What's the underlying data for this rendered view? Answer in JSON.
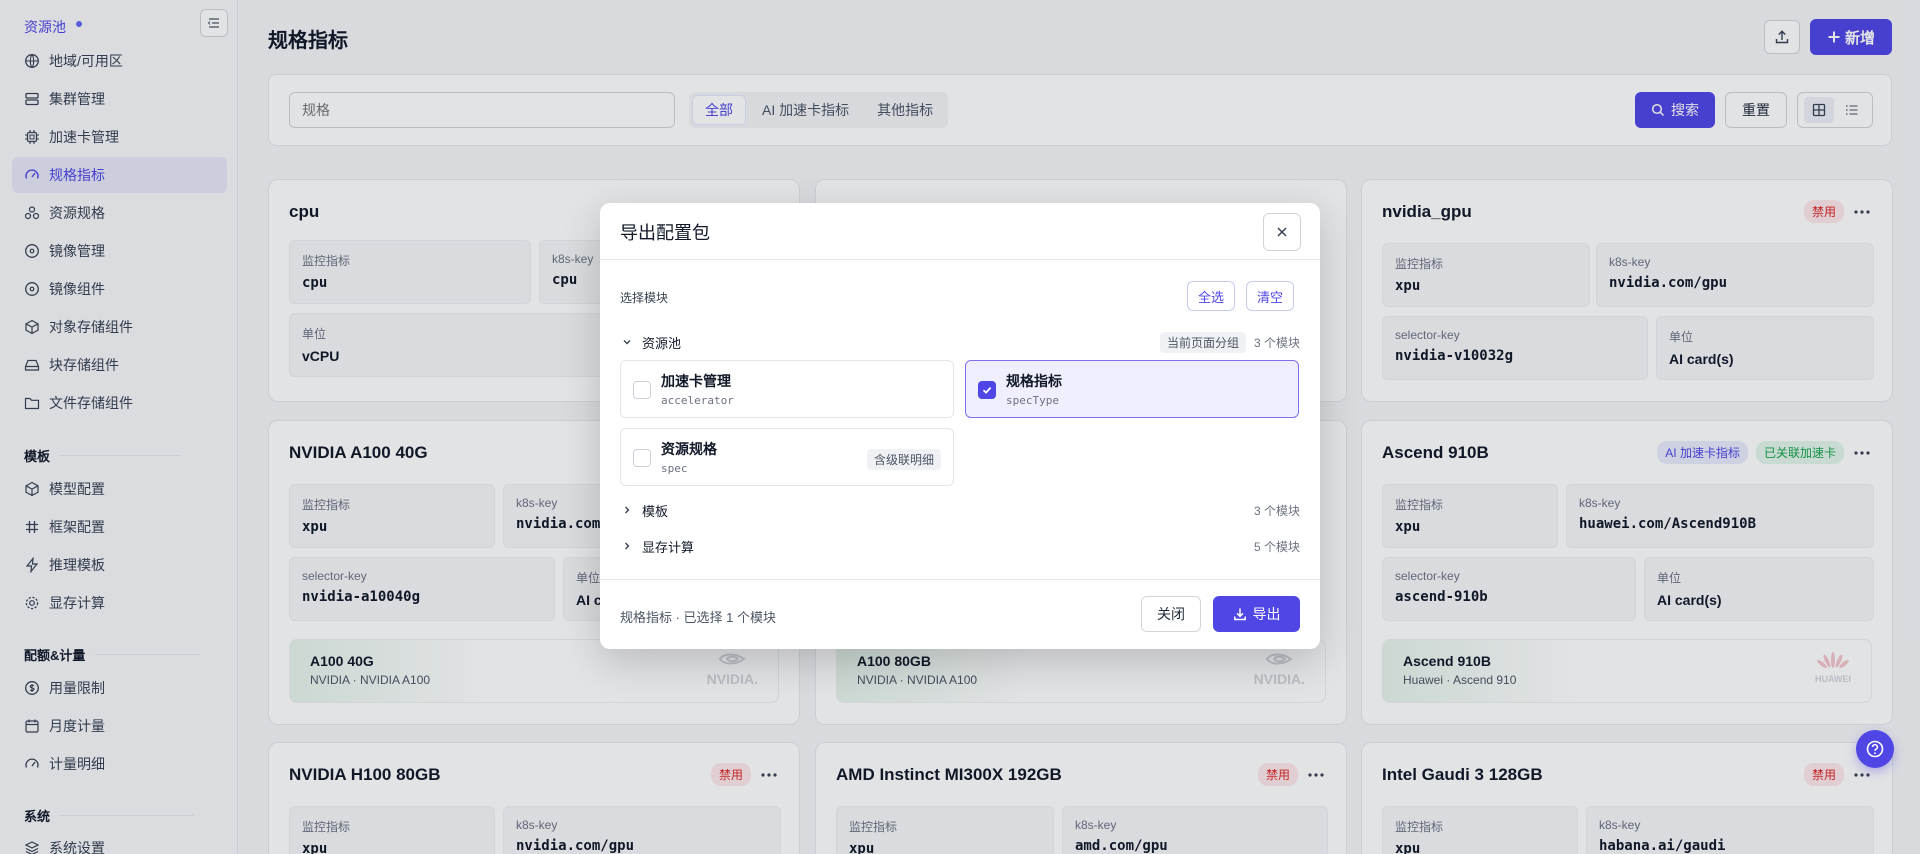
{
  "sidebar": {
    "brand": "资源池",
    "items_pool": [
      {
        "label": "地域/可用区",
        "icon": "globe-icon"
      },
      {
        "label": "集群管理",
        "icon": "server-icon"
      },
      {
        "label": "加速卡管理",
        "icon": "chip-icon"
      },
      {
        "label": "规格指标",
        "icon": "gauge-icon"
      },
      {
        "label": "资源规格",
        "icon": "cluster-icon"
      },
      {
        "label": "镜像管理",
        "icon": "disc-icon"
      },
      {
        "label": "镜像组件",
        "icon": "disc-icon"
      },
      {
        "label": "对象存储组件",
        "icon": "cube-icon"
      },
      {
        "label": "块存储组件",
        "icon": "drive-icon"
      },
      {
        "label": "文件存储组件",
        "icon": "folder-icon"
      }
    ],
    "group_template": "模板",
    "items_template": [
      {
        "label": "模型配置",
        "icon": "cube-icon"
      },
      {
        "label": "框架配置",
        "icon": "hash-icon"
      },
      {
        "label": "推理模板",
        "icon": "bolt-icon"
      },
      {
        "label": "显存计算",
        "icon": "gear-icon"
      }
    ],
    "group_quota": "配额&计量",
    "items_quota": [
      {
        "label": "用量限制",
        "icon": "dollar-icon"
      },
      {
        "label": "月度计量",
        "icon": "calendar-icon"
      },
      {
        "label": "计量明细",
        "icon": "gauge-icon"
      }
    ],
    "group_system": "系统",
    "items_system": [
      {
        "label": "系统设置",
        "icon": "layers-icon"
      }
    ]
  },
  "header": {
    "title": "规格指标",
    "new_label": "新增"
  },
  "filters": {
    "search_placeholder": "规格",
    "segments": [
      "全部",
      "AI 加速卡指标",
      "其他指标"
    ],
    "search_label": "搜索",
    "reset_label": "重置"
  },
  "cards": [
    {
      "title": "cpu",
      "fields": [
        {
          "label": "监控指标",
          "value": "cpu"
        },
        {
          "label": "k8s-key",
          "value": "cpu"
        },
        {
          "label": "单位",
          "value": "vCPU"
        }
      ]
    },
    {
      "title": "nvidia_gpu",
      "badge": "禁用",
      "fields": [
        {
          "label": "监控指标",
          "value": "xpu"
        },
        {
          "label": "k8s-key",
          "value": "nvidia.com/gpu"
        },
        {
          "label": "selector-key",
          "value": "nvidia-v10032g"
        },
        {
          "label": "单位",
          "value": "AI card(s)"
        }
      ]
    },
    {
      "title": "NVIDIA A100 40G",
      "fields": [
        {
          "label": "监控指标",
          "value": "xpu"
        },
        {
          "label": "k8s-key",
          "value": "nvidia.com"
        },
        {
          "label": "selector-key",
          "value": "nvidia-a10040g"
        },
        {
          "label": "单位",
          "value": "AI c"
        }
      ],
      "accel": {
        "name": "A100 40G",
        "sub": "NVIDIA · NVIDIA A100",
        "logo": "NVIDIA."
      }
    },
    {
      "accel": {
        "name": "A100 80GB",
        "sub": "NVIDIA · NVIDIA A100",
        "logo": "NVIDIA."
      }
    },
    {
      "title": "Ascend 910B",
      "badges": [
        "AI 加速卡指标",
        "已关联加速卡"
      ],
      "fields": [
        {
          "label": "监控指标",
          "value": "xpu"
        },
        {
          "label": "k8s-key",
          "value": "huawei.com/Ascend910B"
        },
        {
          "label": "selector-key",
          "value": "ascend-910b"
        },
        {
          "label": "单位",
          "value": "AI card(s)"
        }
      ],
      "accel": {
        "name": "Ascend 910B",
        "sub": "Huawei · Ascend 910",
        "logo": "HUAWEI"
      }
    },
    {
      "title": "NVIDIA H100 80GB",
      "badge": "禁用",
      "fields": [
        {
          "label": "监控指标",
          "value": "xpu"
        },
        {
          "label": "k8s-key",
          "value": "nvidia.com/gpu"
        }
      ]
    },
    {
      "title": "AMD Instinct MI300X 192GB",
      "badge": "禁用",
      "fields": [
        {
          "label": "监控指标",
          "value": "xpu"
        },
        {
          "label": "k8s-key",
          "value": "amd.com/gpu"
        }
      ]
    },
    {
      "title": "Intel Gaudi 3 128GB",
      "badge": "禁用",
      "fields": [
        {
          "label": "监控指标",
          "value": "xpu"
        },
        {
          "label": "k8s-key",
          "value": "habana.ai/gaudi"
        }
      ]
    }
  ],
  "modal": {
    "title": "导出配置包",
    "select_label": "选择模块",
    "select_all": "全选",
    "clear": "清空",
    "groups": [
      {
        "name": "资源池",
        "tag": "当前页面分组",
        "count": "3 个模块"
      },
      {
        "name": "模板",
        "count": "3 个模块"
      },
      {
        "name": "显存计算",
        "count": "5 个模块"
      }
    ],
    "modules": [
      {
        "title": "加速卡管理",
        "code": "accelerator",
        "checked": false
      },
      {
        "title": "规格指标",
        "code": "specType",
        "checked": true
      },
      {
        "title": "资源规格",
        "code": "spec",
        "checked": false,
        "tag": "含级联明细"
      }
    ],
    "footer_info": "规格指标 · 已选择 1 个模块",
    "close_label": "关闭",
    "export_label": "导出"
  },
  "colors": {
    "accent": "#4f46e5",
    "danger": "#dc2626",
    "success": "#16a34a"
  }
}
